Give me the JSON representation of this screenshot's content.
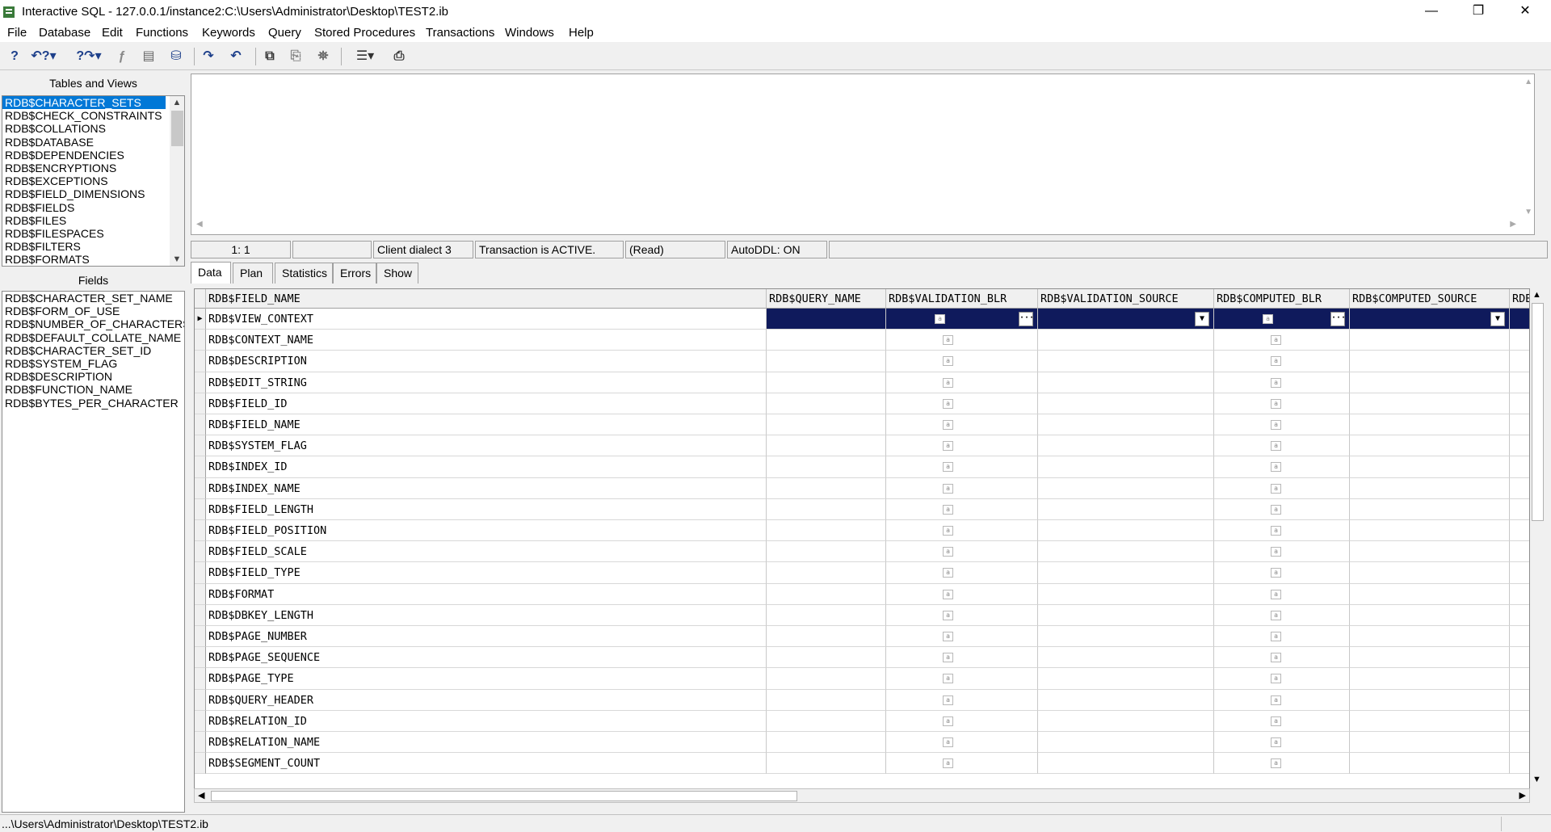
{
  "window": {
    "title": "Interactive SQL - 127.0.0.1/instance2:C:\\Users\\Administrator\\Desktop\\TEST2.ib",
    "minimize": "—",
    "restore": "❐",
    "close": "✕"
  },
  "menu": [
    "File",
    "Database",
    "Edit",
    "Functions",
    "Keywords",
    "Query",
    "Stored Procedures",
    "Transactions",
    "Windows",
    "Help"
  ],
  "toolbar": {
    "icons": [
      "help-icon",
      "help-prev-icon",
      "help-next-icon",
      "function-icon",
      "notepad-icon",
      "database-icon",
      "redo-icon",
      "undo-icon",
      "run-icon",
      "copy-icon",
      "binoculars-icon",
      "properties-icon",
      "print-icon"
    ]
  },
  "tables_panel": {
    "header": "Tables and Views",
    "items": [
      "RDB$CHARACTER_SETS",
      "RDB$CHECK_CONSTRAINTS",
      "RDB$COLLATIONS",
      "RDB$DATABASE",
      "RDB$DEPENDENCIES",
      "RDB$ENCRYPTIONS",
      "RDB$EXCEPTIONS",
      "RDB$FIELD_DIMENSIONS",
      "RDB$FIELDS",
      "RDB$FILES",
      "RDB$FILESPACES",
      "RDB$FILTERS",
      "RDB$FORMATS"
    ]
  },
  "fields_panel": {
    "header": "Fields",
    "items": [
      "RDB$CHARACTER_SET_NAME",
      "RDB$FORM_OF_USE",
      "RDB$NUMBER_OF_CHARACTERS",
      "RDB$DEFAULT_COLLATE_NAME",
      "RDB$CHARACTER_SET_ID",
      "RDB$SYSTEM_FLAG",
      "RDB$DESCRIPTION",
      "RDB$FUNCTION_NAME",
      "RDB$BYTES_PER_CHARACTER"
    ]
  },
  "status": {
    "position": "1: 1",
    "empty": "",
    "dialect": "Client dialect 3",
    "transaction": "Transaction is ACTIVE.",
    "mode": "(Read)",
    "autoddl": "AutoDDL: ON"
  },
  "tabs": [
    "Data",
    "Plan",
    "Statistics",
    "Errors",
    "Show"
  ],
  "grid": {
    "columns": [
      "RDB$FIELD_NAME",
      "RDB$QUERY_NAME",
      "RDB$VALIDATION_BLR",
      "RDB$VALIDATION_SOURCE",
      "RDB$COMPUTED_BLR",
      "RDB$COMPUTED_SOURCE",
      "RDB$"
    ],
    "rows": [
      "RDB$VIEW_CONTEXT",
      "RDB$CONTEXT_NAME",
      "RDB$DESCRIPTION",
      "RDB$EDIT_STRING",
      "RDB$FIELD_ID",
      "RDB$FIELD_NAME",
      "RDB$SYSTEM_FLAG",
      "RDB$INDEX_ID",
      "RDB$INDEX_NAME",
      "RDB$FIELD_LENGTH",
      "RDB$FIELD_POSITION",
      "RDB$FIELD_SCALE",
      "RDB$FIELD_TYPE",
      "RDB$FORMAT",
      "RDB$DBKEY_LENGTH",
      "RDB$PAGE_NUMBER",
      "RDB$PAGE_SEQUENCE",
      "RDB$PAGE_TYPE",
      "RDB$QUERY_HEADER",
      "RDB$RELATION_ID",
      "RDB$RELATION_NAME",
      "RDB$SEGMENT_COUNT"
    ],
    "blob_glyph": "a",
    "ellipsis": "···",
    "dropdown": "▼",
    "row_marker": "▶"
  },
  "bottom_status": {
    "path": "...\\Users\\Administrator\\Desktop\\TEST2.ib"
  }
}
